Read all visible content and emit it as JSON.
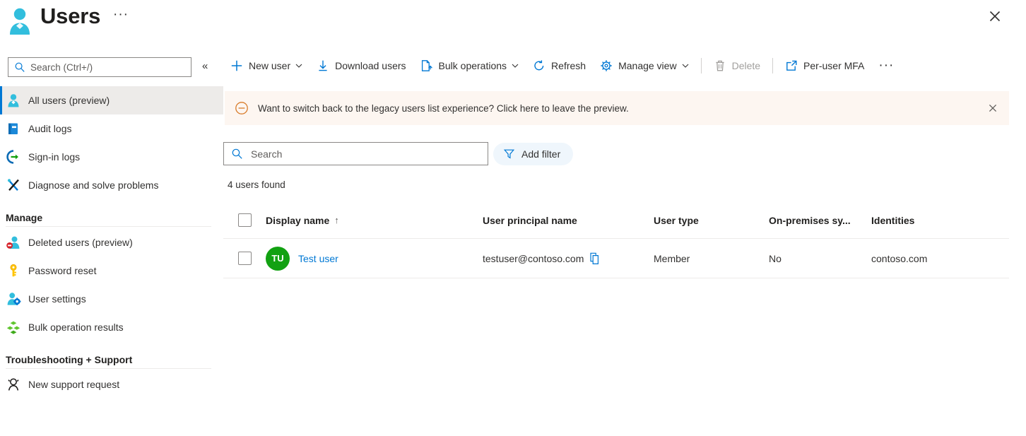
{
  "header": {
    "title": "Users",
    "icon": "user-person-icon",
    "ellipsis": "···",
    "close_icon": "close-icon"
  },
  "sidebar": {
    "search": {
      "placeholder": "Search (Ctrl+/)",
      "value": "",
      "icon": "search-icon"
    },
    "collapse_icon": "«",
    "items": [
      {
        "label": "All users (preview)",
        "icon": "person-icon",
        "selected": true
      },
      {
        "label": "Audit logs",
        "icon": "book-icon",
        "selected": false
      },
      {
        "label": "Sign-in logs",
        "icon": "sign-in-arrow-icon",
        "selected": false
      },
      {
        "label": "Diagnose and solve problems",
        "icon": "wrench-screwdriver-icon",
        "selected": false
      }
    ],
    "groups": [
      {
        "title": "Manage",
        "items": [
          {
            "label": "Deleted users (preview)",
            "icon": "deleted-user-icon"
          },
          {
            "label": "Password reset",
            "icon": "key-icon"
          },
          {
            "label": "User settings",
            "icon": "person-gear-icon"
          },
          {
            "label": "Bulk operation results",
            "icon": "green-cubes-icon"
          }
        ]
      },
      {
        "title": "Troubleshooting + Support",
        "items": [
          {
            "label": "New support request",
            "icon": "support-person-icon"
          }
        ]
      }
    ]
  },
  "commandbar": {
    "items": [
      {
        "label": "New user",
        "icon": "plus-icon",
        "caret": true,
        "disabled": false
      },
      {
        "label": "Download users",
        "icon": "download-arrow-icon",
        "caret": false,
        "disabled": false
      },
      {
        "label": "Bulk operations",
        "icon": "bulk-page-icon",
        "caret": true,
        "disabled": false
      },
      {
        "label": "Refresh",
        "icon": "refresh-icon",
        "caret": false,
        "disabled": false
      },
      {
        "label": "Manage view",
        "icon": "gear-icon",
        "caret": true,
        "disabled": false
      },
      {
        "label": "Delete",
        "icon": "trash-icon",
        "caret": false,
        "disabled": true
      },
      {
        "label": "Per-user MFA",
        "icon": "external-link-icon",
        "caret": false,
        "disabled": false
      }
    ],
    "overflow": "···"
  },
  "banner": {
    "icon": "info-circle-minus-icon",
    "text": "Want to switch back to the legacy users list experience? Click here to leave the preview.",
    "close_icon": "close-icon",
    "background": "#fdf6f1",
    "accent": "#d87b2a"
  },
  "filters": {
    "search": {
      "placeholder": "Search",
      "value": "",
      "icon": "search-icon"
    },
    "add_filter": {
      "label": "Add filter",
      "icon": "funnel-icon"
    }
  },
  "results": {
    "count_text": "4 users found"
  },
  "table": {
    "select_all_checkbox": "unchecked",
    "columns": [
      {
        "label": "Display name",
        "sorted": true,
        "sort_arrow": "↑"
      },
      {
        "label": "User principal name",
        "sorted": false,
        "sort_arrow": ""
      },
      {
        "label": "User type",
        "sorted": false,
        "sort_arrow": ""
      },
      {
        "label": "On-premises sy...",
        "sorted": false,
        "sort_arrow": ""
      },
      {
        "label": "Identities",
        "sorted": false,
        "sort_arrow": ""
      }
    ],
    "rows": [
      {
        "checkbox": "unchecked",
        "avatar_initials": "TU",
        "avatar_color": "#12a112",
        "display_name": "Test user",
        "user_principal_name": "testuser@contoso.com",
        "copy_icon": "copy-icon",
        "user_type": "Member",
        "on_premises_sync": "No",
        "identities": "contoso.com"
      }
    ]
  },
  "colors": {
    "accent": "#0078d4",
    "selected_row_bg": "#edebe9",
    "avatar_green": "#12a112"
  }
}
